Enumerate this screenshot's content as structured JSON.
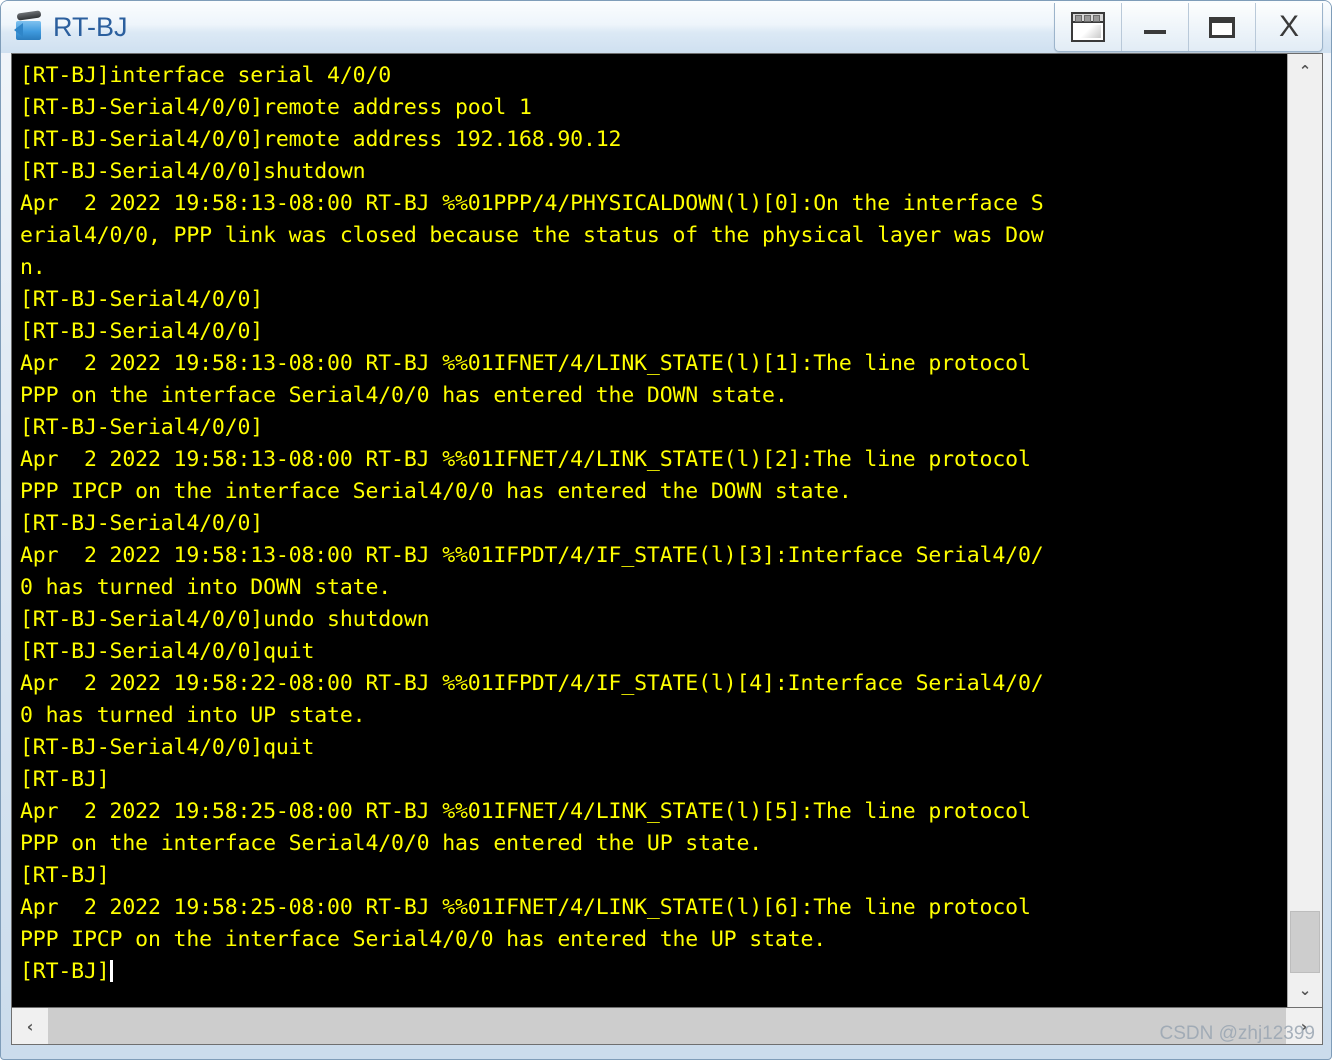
{
  "window": {
    "title": "RT-BJ",
    "icon": "router-icon",
    "controls": [
      {
        "name": "restore-window-button",
        "icon": "window-restore-icon",
        "label": ""
      },
      {
        "name": "minimize-button",
        "icon": "minimize-icon",
        "label": ""
      },
      {
        "name": "maximize-button",
        "icon": "maximize-icon",
        "label": ""
      },
      {
        "name": "close-button",
        "icon": "close-icon",
        "label": "X"
      }
    ]
  },
  "terminal": {
    "background_color": "#000000",
    "text_color": "#ffff00",
    "cursor_color": "#ffffff",
    "lines": [
      "[RT-BJ]interface serial 4/0/0",
      "[RT-BJ-Serial4/0/0]remote address pool 1",
      "[RT-BJ-Serial4/0/0]remote address 192.168.90.12",
      "[RT-BJ-Serial4/0/0]shutdown",
      "Apr  2 2022 19:58:13-08:00 RT-BJ %%01PPP/4/PHYSICALDOWN(l)[0]:On the interface S",
      "erial4/0/0, PPP link was closed because the status of the physical layer was Dow",
      "n.",
      "[RT-BJ-Serial4/0/0]",
      "[RT-BJ-Serial4/0/0]",
      "Apr  2 2022 19:58:13-08:00 RT-BJ %%01IFNET/4/LINK_STATE(l)[1]:The line protocol ",
      "PPP on the interface Serial4/0/0 has entered the DOWN state.",
      "[RT-BJ-Serial4/0/0]",
      "Apr  2 2022 19:58:13-08:00 RT-BJ %%01IFNET/4/LINK_STATE(l)[2]:The line protocol ",
      "PPP IPCP on the interface Serial4/0/0 has entered the DOWN state.",
      "[RT-BJ-Serial4/0/0]",
      "Apr  2 2022 19:58:13-08:00 RT-BJ %%01IFPDT/4/IF_STATE(l)[3]:Interface Serial4/0/",
      "0 has turned into DOWN state.",
      "[RT-BJ-Serial4/0/0]undo shutdown",
      "[RT-BJ-Serial4/0/0]quit",
      "Apr  2 2022 19:58:22-08:00 RT-BJ %%01IFPDT/4/IF_STATE(l)[4]:Interface Serial4/0/",
      "0 has turned into UP state.",
      "[RT-BJ-Serial4/0/0]quit",
      "[RT-BJ]",
      "Apr  2 2022 19:58:25-08:00 RT-BJ %%01IFNET/4/LINK_STATE(l)[5]:The line protocol ",
      "PPP on the interface Serial4/0/0 has entered the UP state.",
      "[RT-BJ]",
      "Apr  2 2022 19:58:25-08:00 RT-BJ %%01IFNET/4/LINK_STATE(l)[6]:The line protocol ",
      "PPP IPCP on the interface Serial4/0/0 has entered the UP state."
    ],
    "prompt_line": "[RT-BJ]"
  },
  "scrollbars": {
    "vertical": {
      "up_arrow": "⌃",
      "down_arrow": "⌄",
      "thumb_position": "bottom"
    },
    "horizontal": {
      "left_arrow": "‹",
      "right_arrow": "›"
    }
  },
  "watermark": {
    "text": "CSDN @zhj12399"
  }
}
